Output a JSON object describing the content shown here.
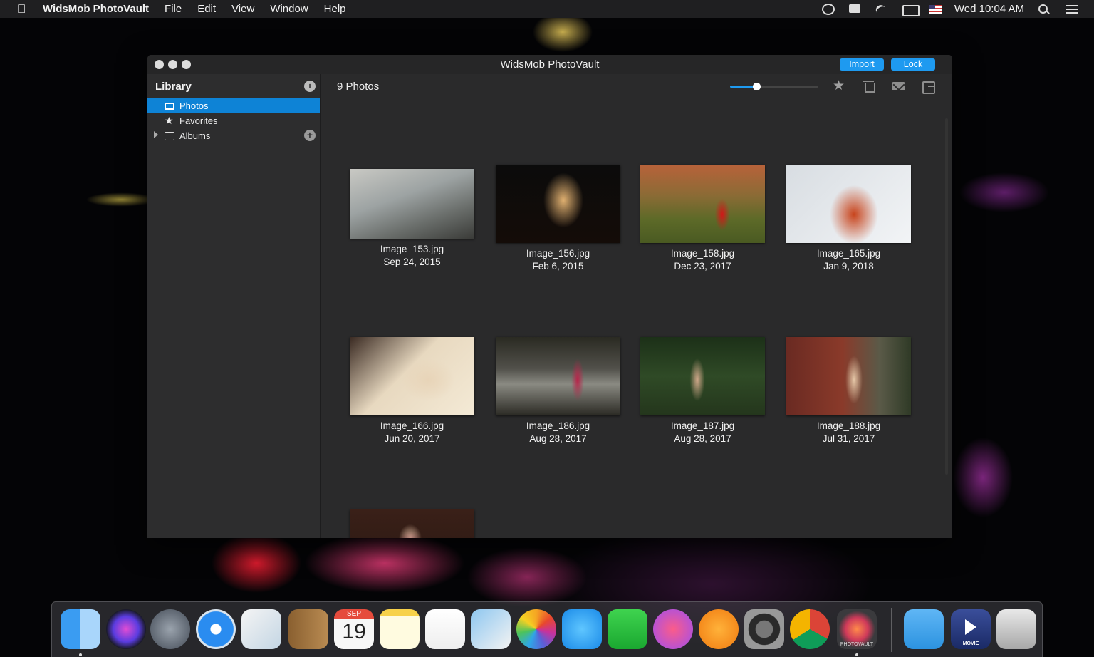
{
  "menubar": {
    "apple": "",
    "app_name": "WidsMob PhotoVault",
    "menus": [
      "File",
      "Edit",
      "View",
      "Window",
      "Help"
    ],
    "status_icons": [
      "creative-cloud-icon",
      "notification-icon",
      "airplay-icon",
      "display-icon",
      "us-flag-icon"
    ],
    "clock": "Wed 10:04 AM"
  },
  "window": {
    "title": "WidsMob PhotoVault",
    "import_label": "Import",
    "lock_label": "Lock",
    "accent": "#1e9af0"
  },
  "sidebar": {
    "header": "Library",
    "items": [
      {
        "label": "Photos",
        "icon": "photos-icon",
        "selected": true
      },
      {
        "label": "Favorites",
        "icon": "star-icon",
        "selected": false
      },
      {
        "label": "Albums",
        "icon": "album-icon",
        "selected": false
      }
    ]
  },
  "content": {
    "count_label": "9 Photos",
    "zoom_level": 0.3,
    "photos": [
      {
        "name": "Image_153.jpg",
        "date": "Sep 24, 2015"
      },
      {
        "name": "Image_156.jpg",
        "date": "Feb 6, 2015"
      },
      {
        "name": "Image_158.jpg",
        "date": "Dec 23, 2017"
      },
      {
        "name": "Image_165.jpg",
        "date": "Jan 9, 2018"
      },
      {
        "name": "Image_166.jpg",
        "date": "Jun 20, 2017"
      },
      {
        "name": "Image_186.jpg",
        "date": "Aug 28, 2017"
      },
      {
        "name": "Image_187.jpg",
        "date": "Aug 28, 2017"
      },
      {
        "name": "Image_188.jpg",
        "date": "Jul 31, 2017"
      },
      {
        "name": "",
        "date": ""
      }
    ]
  },
  "dock": {
    "apps": [
      "finder",
      "siri",
      "launchpad",
      "safari",
      "mail",
      "contacts",
      "calendar",
      "notes",
      "reminders",
      "preview",
      "photos",
      "messages",
      "facetime",
      "itunes",
      "ibooks",
      "system-preferences",
      "chrome",
      "photovault",
      "folder",
      "movie",
      "trash"
    ],
    "calendar_month": "SEP",
    "calendar_day": "19",
    "photovault_label": "PHOTOVAULT",
    "movie_label": "MOVIE"
  }
}
